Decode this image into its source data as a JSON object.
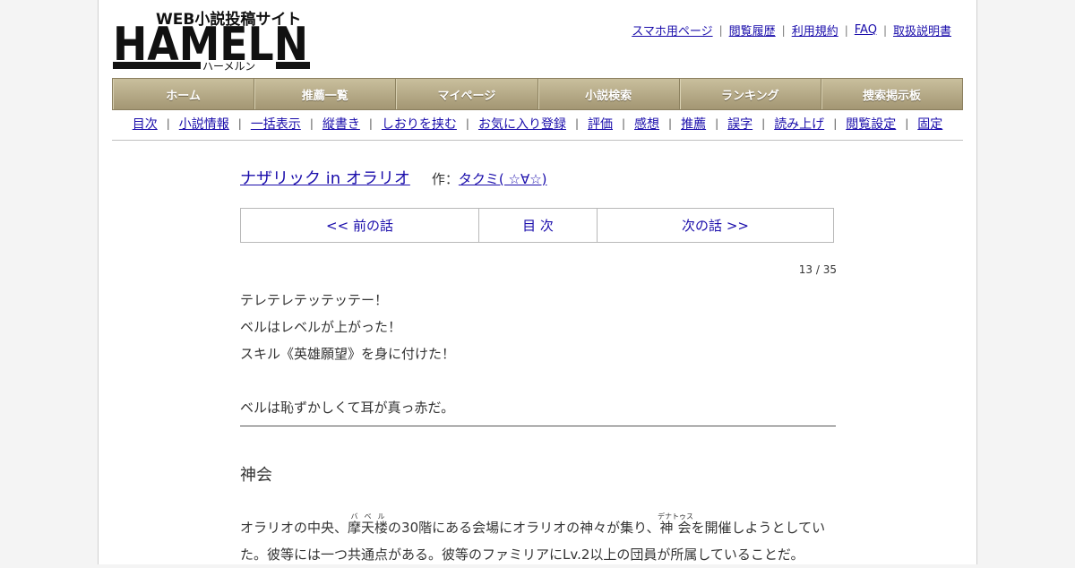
{
  "header": {
    "logo_tagline": "WEB小説投稿サイト",
    "logo_word": "HAMELN",
    "logo_kana": "ハーメルン",
    "links": [
      "スマホ用ページ",
      "閲覧履歴",
      "利用規約",
      "FAQ",
      "取扱説明書"
    ]
  },
  "global_nav": [
    "ホーム",
    "推薦一覧",
    "マイページ",
    "小説検索",
    "ランキング",
    "捜索掲示板"
  ],
  "novel_nav": [
    "目次",
    "小説情報",
    "一括表示",
    "縦書き",
    "しおりを挟む",
    "お気に入り登録",
    "評価",
    "感想",
    "推薦",
    "誤字",
    "読み上げ",
    "閲覧設定",
    "固定"
  ],
  "novel": {
    "title": "ナザリック in オラリオ",
    "author_label": "作：",
    "author": "タクミ( ☆∀☆)"
  },
  "pager": {
    "prev": "<< 前の話",
    "toc": "目 次",
    "next": "次の話 >>"
  },
  "counter": "13 / 35",
  "preface": [
    "テレテレテッテッテー！",
    "ベルはレベルが上がった！",
    "スキル《英雄願望》を身に付けた！",
    "",
    "ベルは恥ずかしくて耳が真っ赤だ。"
  ],
  "chapter_title": "神会",
  "body": {
    "line1_a": "オラリオの中央、",
    "ruby1_base": "摩天楼",
    "ruby1_text": "バベル",
    "line1_b": "の30階にある会場にオラリオの神々が集り、",
    "ruby2_base": "神会",
    "ruby2_text": "デナトゥス",
    "line1_c": "を開催しようとしてい",
    "line2": "た。彼等には一つ共通点がある。彼等のファミリアにLv.2以上の団員が所属していることだ。"
  }
}
